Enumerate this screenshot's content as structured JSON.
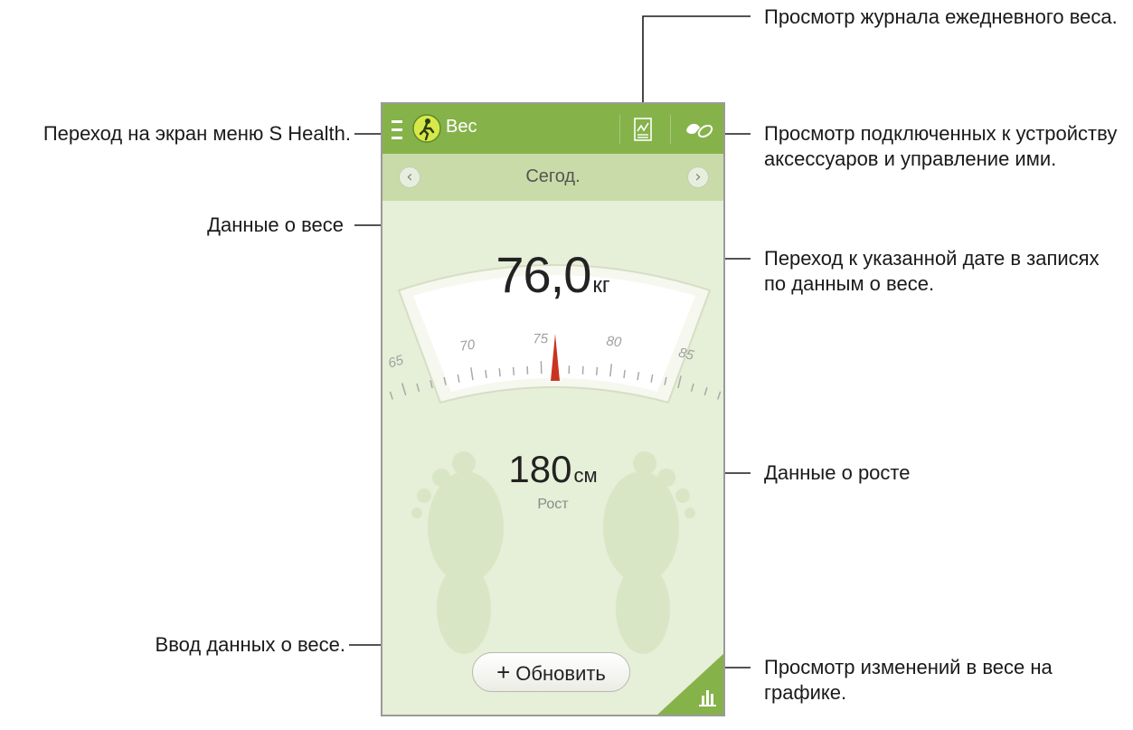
{
  "app": {
    "title": "Вес",
    "date_label": "Сегод.",
    "prev_icon": "‹",
    "next_icon": "›",
    "weight_value": "76,0",
    "weight_unit": "кг",
    "weight_kg": 76.0,
    "scale_ticks": [
      "65",
      "70",
      "75",
      "80",
      "85"
    ],
    "height_value": "180",
    "height_unit": "см",
    "height_label": "Рост",
    "update_button": "Обновить",
    "update_icon": "+",
    "colors": {
      "action_bar": "#86b24a",
      "date_bar": "#c9dba8",
      "background": "#e6efd7",
      "needle": "#c8341e"
    },
    "icons": [
      "menu-icon",
      "app-logo-icon",
      "weight-log-icon",
      "accessories-icon",
      "graph-icon"
    ]
  },
  "callouts": {
    "log": "Просмотр журнала ежедневного веса.",
    "menu": "Переход на экран меню S Health.",
    "accessories": "Просмотр подключенных к устройству аксессуаров и управление ими.",
    "date": "Переход к указанной дате в записях по данным о весе.",
    "weight": "Данные о весе",
    "height": "Данные о росте",
    "input": "Ввод данных о весе.",
    "graph": "Просмотр изменений в весе на графике."
  }
}
